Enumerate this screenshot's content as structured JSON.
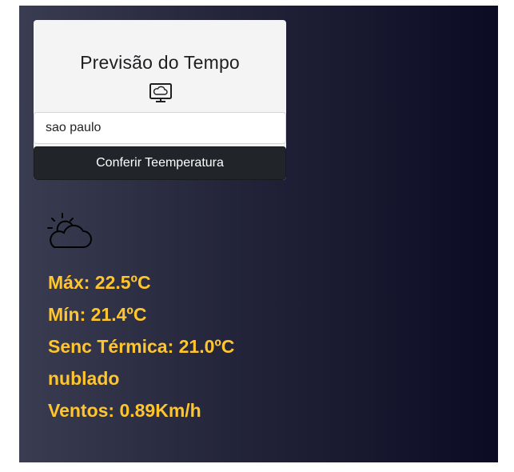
{
  "card": {
    "title": "Previsão do Tempo",
    "icon": "monitor-cloud-icon"
  },
  "search": {
    "value": "sao paulo",
    "placeholder": ""
  },
  "button": {
    "label": "Conferir Teemperatura"
  },
  "weather": {
    "icon": "partly-cloudy-icon",
    "max": "Máx: 22.5ºC",
    "min": "Mín: 21.4ºC",
    "feels_like": "Senc Térmica: 21.0ºC",
    "description": "nublado",
    "wind": "Ventos: 0.89Km/h"
  },
  "colors": {
    "accent": "#ffc52b",
    "button_bg": "#212529",
    "card_bg": "#f4f4f4",
    "background_left": "#3a3c52",
    "background_right": "#0c0b24"
  }
}
